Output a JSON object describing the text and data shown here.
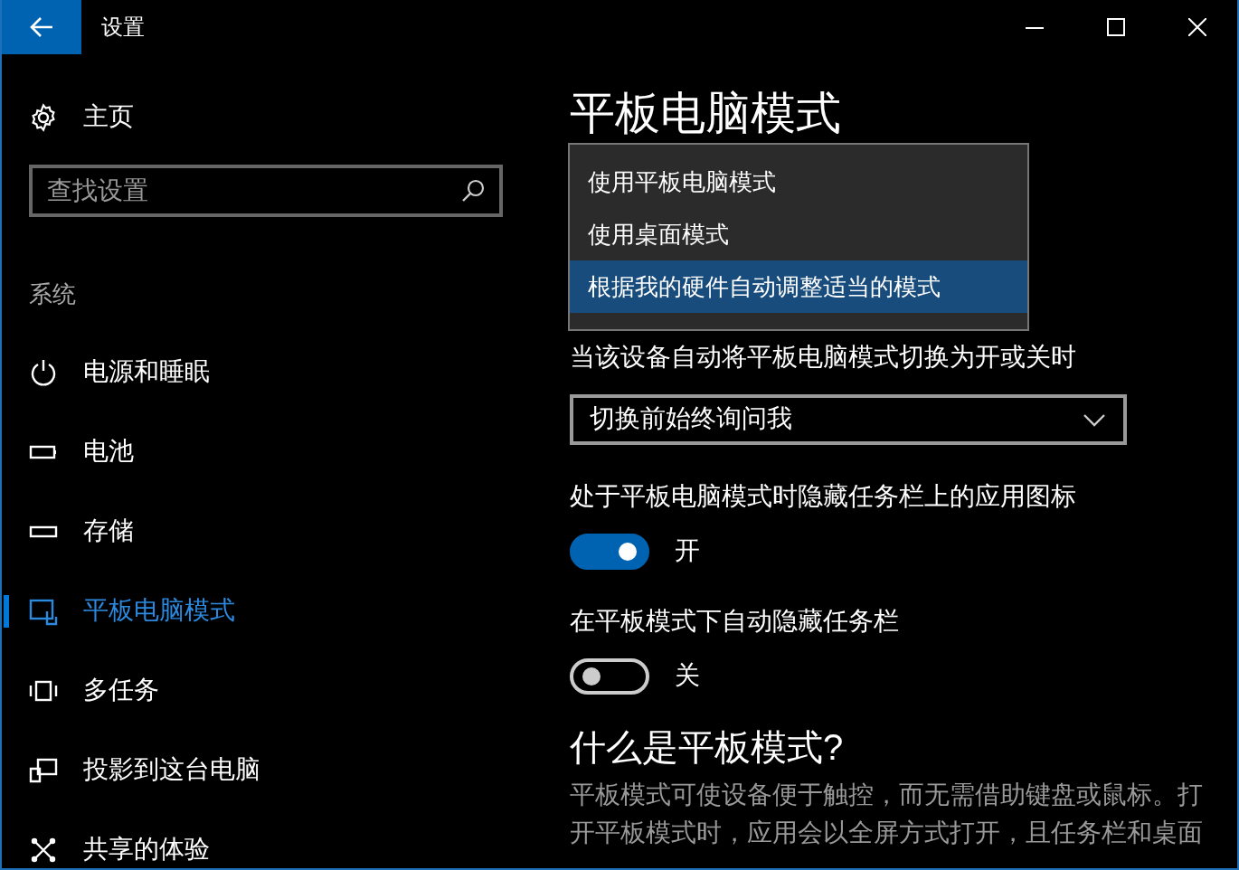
{
  "window": {
    "title": "设置"
  },
  "sidebar": {
    "home": "主页",
    "search": {
      "placeholder": "查找设置"
    },
    "section": "系统",
    "items": [
      {
        "kind": "power",
        "label": "电源和睡眠",
        "selected": false
      },
      {
        "kind": "battery",
        "label": "电池",
        "selected": false
      },
      {
        "kind": "storage",
        "label": "存储",
        "selected": false
      },
      {
        "kind": "tablet",
        "label": "平板电脑模式",
        "selected": true
      },
      {
        "kind": "multitask",
        "label": "多任务",
        "selected": false
      },
      {
        "kind": "project",
        "label": "投影到这台电脑",
        "selected": false
      },
      {
        "kind": "share",
        "label": "共享的体验",
        "selected": false
      }
    ]
  },
  "main": {
    "title": "平板电脑模式",
    "mode_menu": {
      "options": [
        {
          "label": "使用平板电脑模式",
          "selected": false
        },
        {
          "label": "使用桌面模式",
          "selected": false
        },
        {
          "label": "根据我的硬件自动调整适当的模式",
          "selected": true
        }
      ]
    },
    "settings": [
      {
        "kind": "combo",
        "label": "当该设备自动将平板电脑模式切换为开或关时",
        "value": "切换前始终询问我"
      },
      {
        "kind": "toggle",
        "label": "处于平板电脑模式时隐藏任务栏上的应用图标",
        "on": true,
        "state_text": "开"
      },
      {
        "kind": "toggle",
        "label": "在平板模式下自动隐藏任务栏",
        "on": false,
        "state_text": "关"
      }
    ],
    "about": {
      "title": "什么是平板模式?",
      "text": "平板模式可使设备便于触控，而无需借助键盘或鼠标。打开平板模式时，应用会以全屏方式打开，且任务栏和桌面"
    }
  }
}
